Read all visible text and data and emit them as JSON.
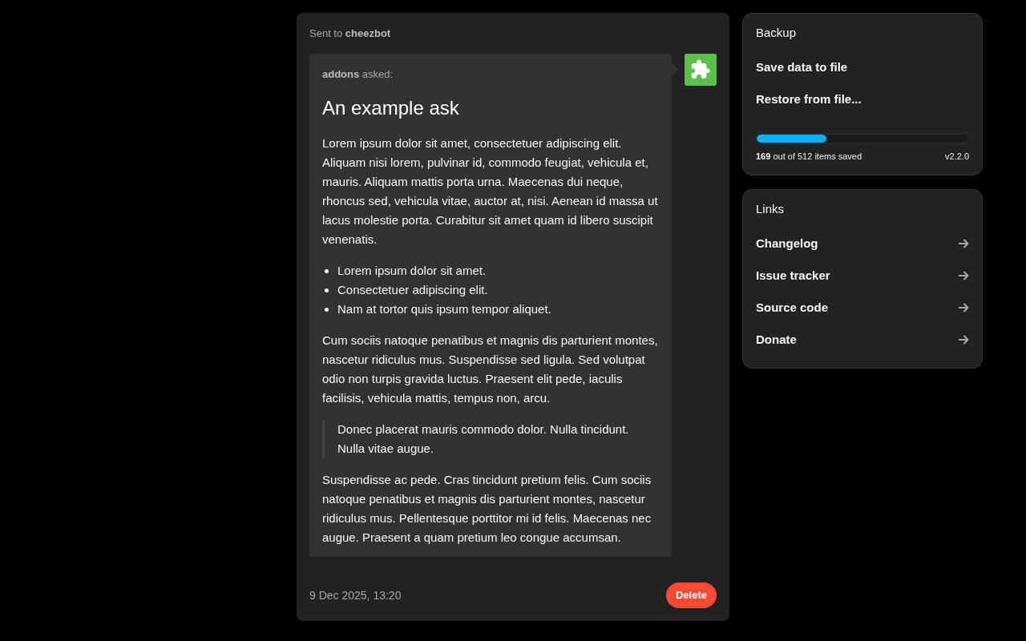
{
  "message": {
    "recipient_line": "Sent to **cheezbot**",
    "asker_line": "**addons** asked:",
    "title": "An example ask",
    "body": [
      {
        "kind": "paragraph",
        "text": "Lorem ipsum dolor sit amet, consectetuer adipiscing elit. Aliquam nisi lorem, pulvinar id, commodo feugiat, vehicula et, mauris. Aliquam mattis porta urna. Maecenas dui neque, rhoncus sed, vehicula vitae, auctor at, nisi. Aenean id massa ut lacus molestie porta. Curabitur sit amet quam id libero suscipit venenatis."
      },
      {
        "kind": "list",
        "items": [
          "Lorem ipsum dolor sit amet.",
          "Consectetuer adipiscing elit.",
          "Nam at tortor quis ipsum tempor aliquet."
        ]
      },
      {
        "kind": "paragraph",
        "text": "Cum sociis natoque penatibus et magnis dis parturient montes, nascetur ridiculus mus. Suspendisse sed ligula. Sed volutpat odio non turpis gravida luctus. Praesent elit pede, iaculis facilisis, vehicula mattis, tempus non, arcu."
      },
      {
        "kind": "quote",
        "text": "Donec placerat mauris commodo dolor. Nulla tincidunt. Nulla vitae augue."
      },
      {
        "kind": "paragraph",
        "text": "Suspendisse ac pede. Cras tincidunt pretium felis. Cum sociis natoque penatibus et magnis dis parturient montes, nascetur ridiculus mus. Pellentesque porttitor mi id felis. Maecenas nec augue. Praesent a quam pretium leo congue accumsan."
      }
    ],
    "timestamp": "9 Dec 2025, 13:20",
    "delete_button": "Delete"
  },
  "backup": {
    "title": "Backup",
    "actions": [
      "Save data to file",
      "Restore from file..."
    ],
    "progress": {
      "level": 0.33,
      "caption": "**169** out of 512 items saved",
      "version": "v2.2.0"
    }
  },
  "links": {
    "title": "Links",
    "items": [
      "Changelog",
      "Issue tracker",
      "Source code",
      "Donate"
    ]
  }
}
